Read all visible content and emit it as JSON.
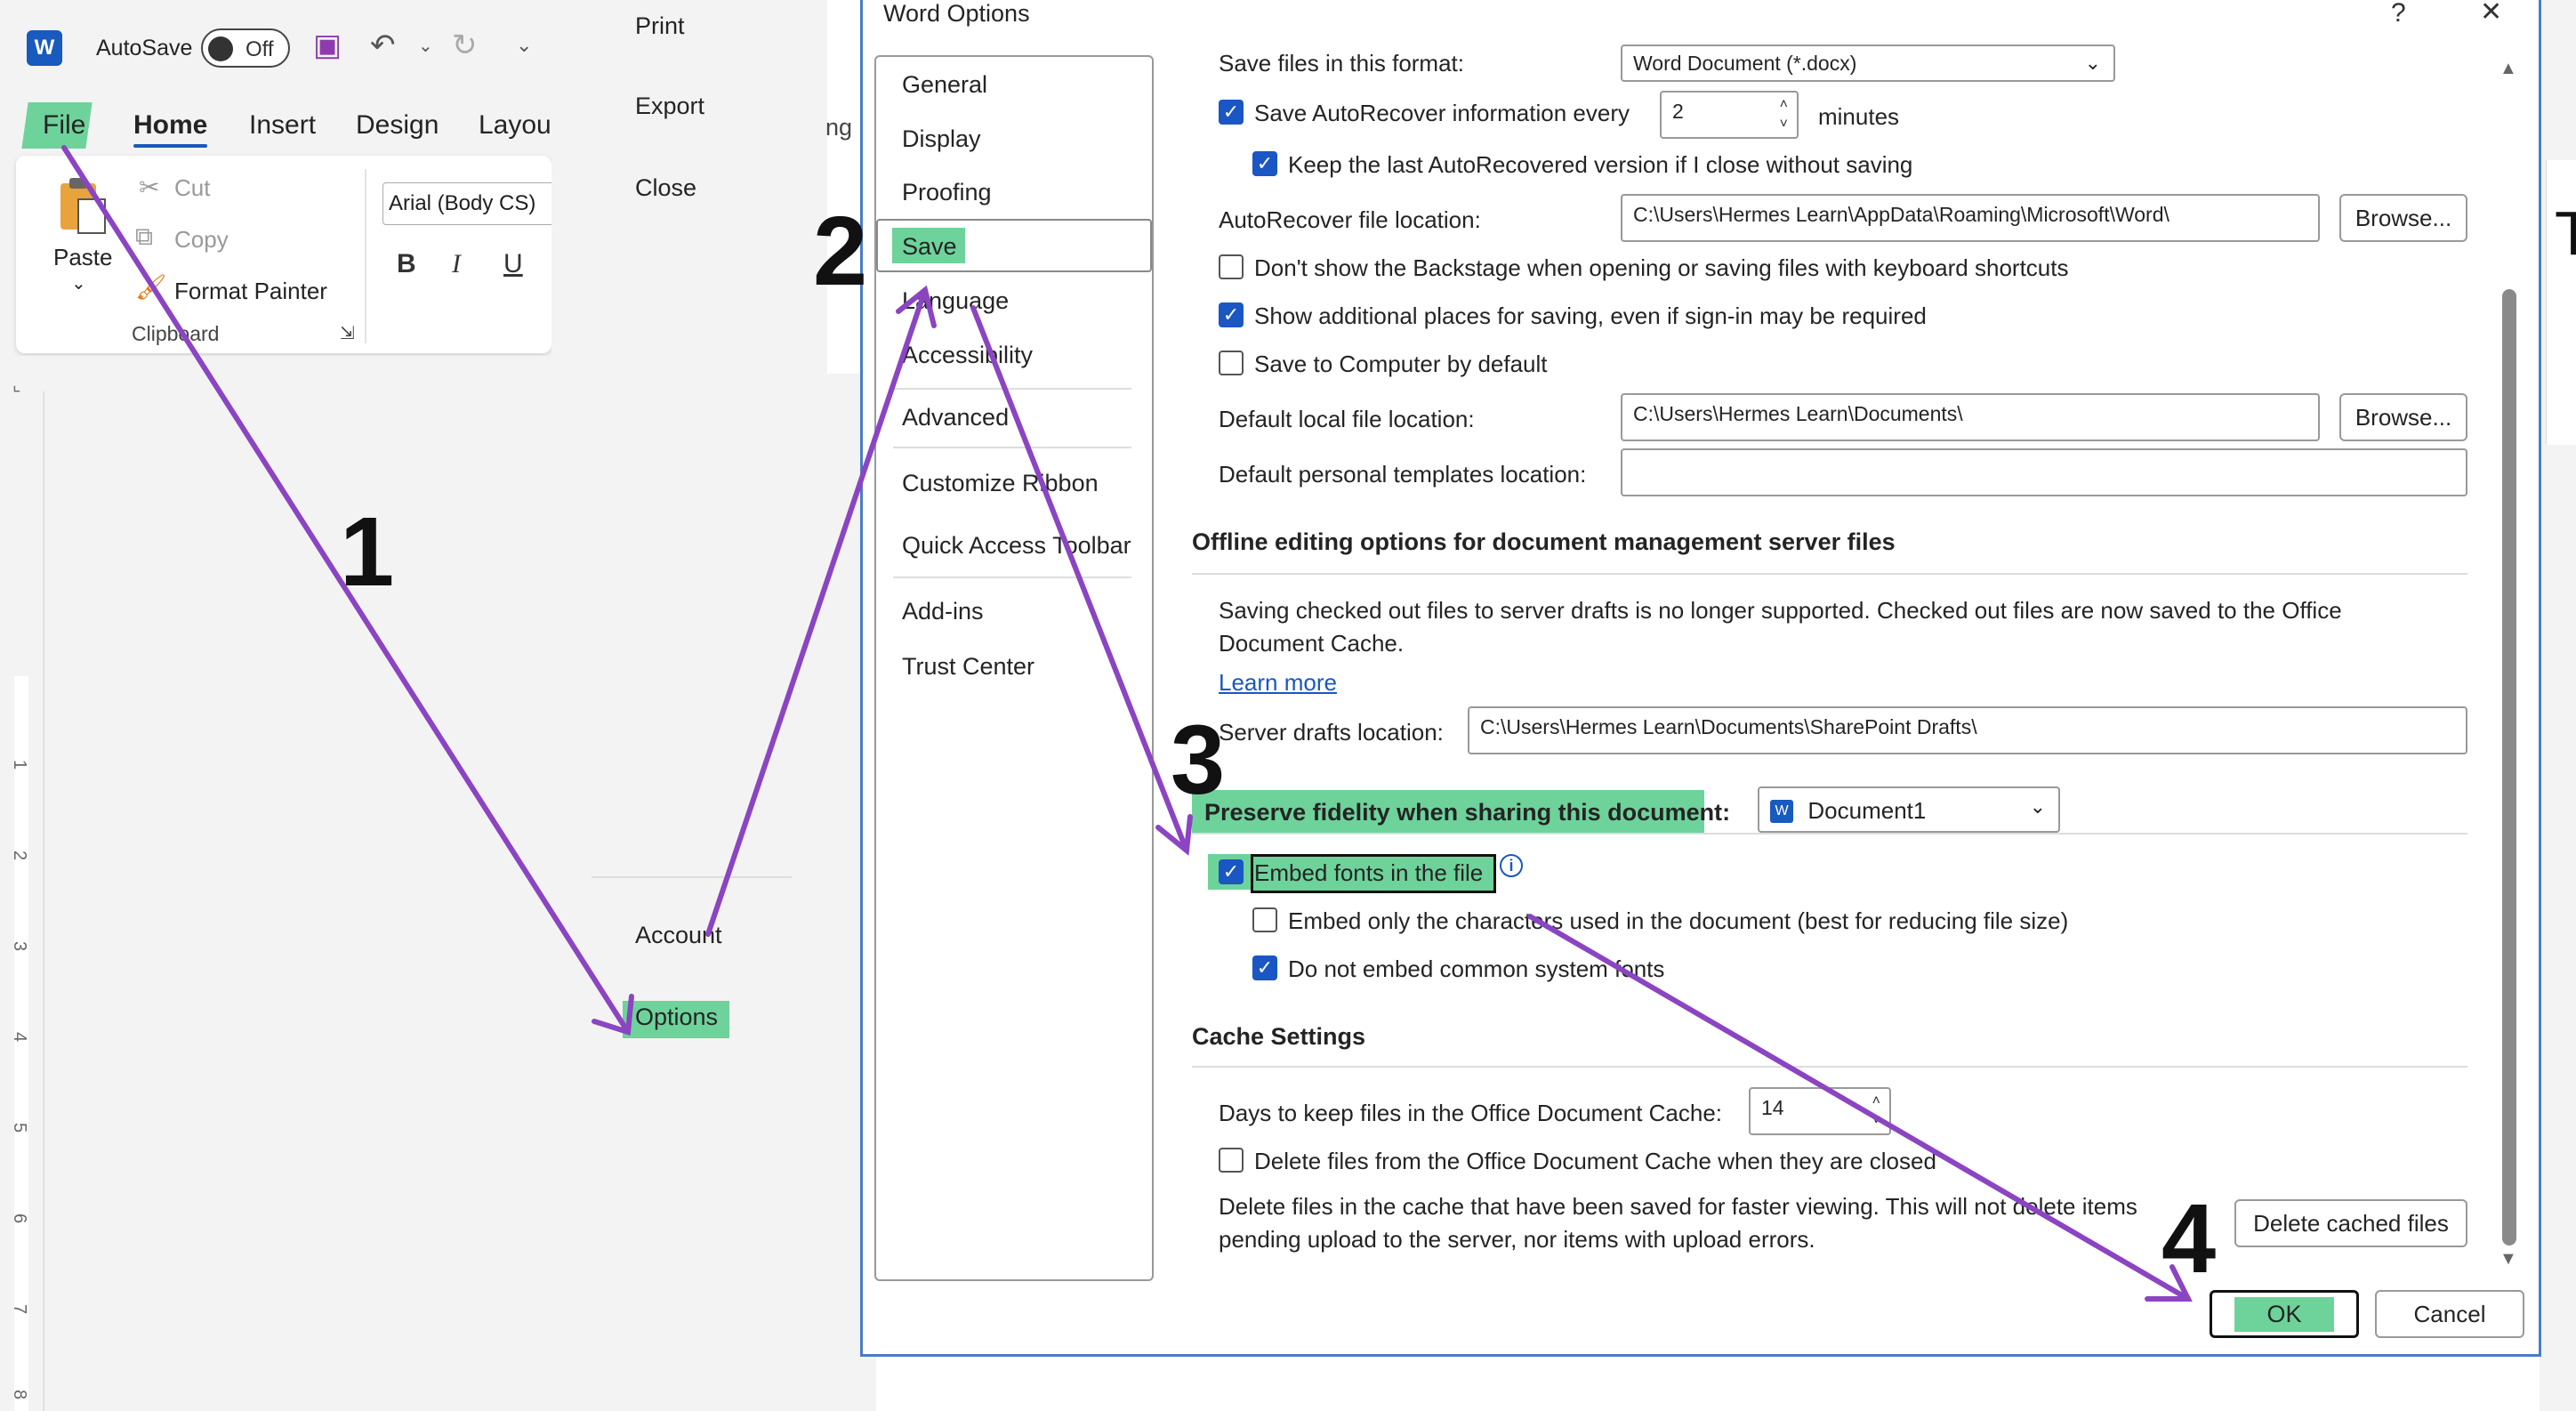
{
  "app": {
    "logo_letter": "W",
    "autosave_label": "AutoSave",
    "autosave_state": "Off"
  },
  "ribbon": {
    "tabs": [
      "File",
      "Home",
      "Insert",
      "Design",
      "Layou"
    ],
    "paste_label": "Paste",
    "cut_label": "Cut",
    "copy_label": "Copy",
    "format_painter_label": "Format Painter",
    "clipboard_group_label": "Clipboard",
    "font_name": "Arial (Body CS)",
    "bold_label": "B",
    "italic_label": "I",
    "underline_label": "U"
  },
  "ruler": {
    "numbers": [
      "1",
      "2",
      "3",
      "4",
      "5",
      "6",
      "7",
      "8"
    ]
  },
  "backstage": {
    "print": "Print",
    "export": "Export",
    "close": "Close",
    "account": "Account",
    "options": "Options",
    "partial_text": "ng"
  },
  "dialog": {
    "title": "Word Options",
    "help": "?",
    "close": "✕",
    "nav": [
      "General",
      "Display",
      "Proofing",
      "Save",
      "Language",
      "Accessibility",
      "Advanced",
      "Customize Ribbon",
      "Quick Access Toolbar",
      "Add-ins",
      "Trust Center"
    ],
    "selected_nav": "Save",
    "save_format_label": "Save files in this format:",
    "save_format_value": "Word Document (*.docx)",
    "autorecover_label": "Save AutoRecover information every",
    "autorecover_minutes": "2",
    "minutes_label": "minutes",
    "keep_last_label": "Keep the last AutoRecovered version if I close without saving",
    "autorecover_location_label": "AutoRecover file location:",
    "autorecover_location_value": "C:\\Users\\Hermes Learn\\AppData\\Roaming\\Microsoft\\Word\\",
    "browse_label": "Browse...",
    "dont_show_backstage_label": "Don't show the Backstage when opening or saving files with keyboard shortcuts",
    "show_additional_label": "Show additional places for saving, even if sign-in may be required",
    "save_to_computer_label": "Save to Computer by default",
    "default_local_label": "Default local file location:",
    "default_local_value": "C:\\Users\\Hermes Learn\\Documents\\",
    "default_templates_label": "Default personal templates location:",
    "default_templates_value": "",
    "offline_heading": "Offline editing options for document management server files",
    "offline_text": "Saving checked out files to server drafts is no longer supported. Checked out files are now saved to the Office Document Cache.",
    "learn_more": "Learn more",
    "server_drafts_label": "Server drafts location:",
    "server_drafts_value": "C:\\Users\\Hermes Learn\\Documents\\SharePoint Drafts\\",
    "fidelity_label": "Preserve fidelity when sharing this document:",
    "fidelity_doc": "Document1",
    "embed_fonts_label": "Embed fonts in the file",
    "embed_only_label": "Embed only the characters used in the document (best for reducing file size)",
    "do_not_embed_label": "Do not embed common system fonts",
    "cache_heading": "Cache Settings",
    "days_label": "Days to keep files in the Office Document Cache:",
    "days_value": "14",
    "delete_cache_label": "Delete files from the Office Document Cache when they are closed",
    "delete_info_text": "Delete files in the cache that have been saved for faster viewing. This will not delete items pending upload to the server, nor items with upload errors.",
    "delete_cached_btn": "Delete cached files",
    "ok_label": "OK",
    "cancel_label": "Cancel"
  },
  "annotations": {
    "step1": "1",
    "step2": "2",
    "step3": "3",
    "step4": "4",
    "arrow_color": "#8b44c2",
    "highlight_color": "#6dd39a"
  },
  "partial_right": "T"
}
